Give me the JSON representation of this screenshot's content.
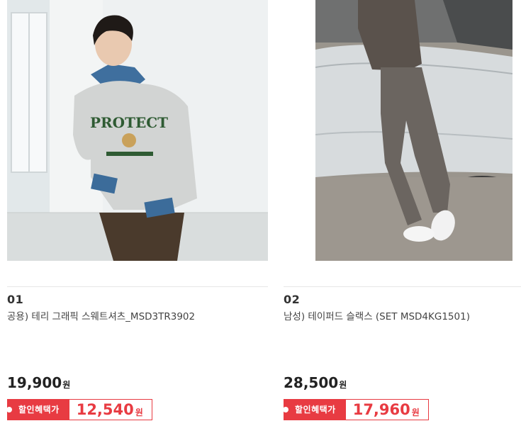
{
  "products": [
    {
      "rank": "01",
      "name": "공용) 테리 그래픽 스웨트셔츠_MSD3TR3902",
      "price": "19,900",
      "price_unit": "원",
      "sale_label": "할인혜택가",
      "sale_price": "12,540",
      "sale_unit": "원",
      "image_graphic_text": "PROTECT"
    },
    {
      "rank": "02",
      "name": "남성) 테이퍼드 슬랙스 (SET MSD4KG1501)",
      "price": "28,500",
      "price_unit": "원",
      "sale_label": "할인혜택가",
      "sale_price": "17,960",
      "sale_unit": "원"
    }
  ],
  "colors": {
    "accent": "#e83b42",
    "text": "#222222",
    "divider": "#e6e6e6"
  }
}
